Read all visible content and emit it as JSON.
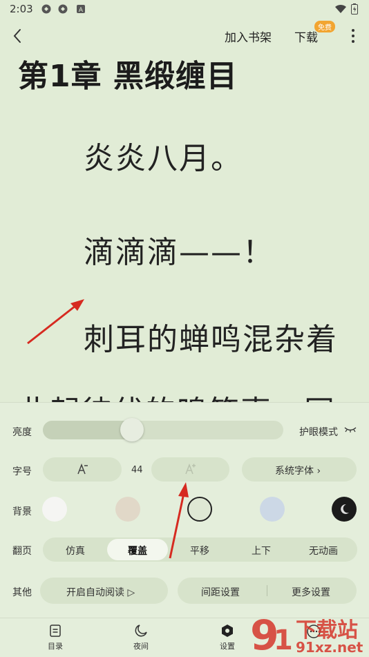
{
  "status_bar": {
    "time": "2:03"
  },
  "top_bar": {
    "add_to_shelf": "加入书架",
    "download": "下载",
    "free_badge": "免费"
  },
  "reader": {
    "chapter_title": "第1章 黑缎缠目",
    "paragraphs": [
      "炎炎八月。",
      "滴滴滴——！",
      "刺耳的蝉鸣混杂着",
      "此起彼伏的鸣笛声，同"
    ]
  },
  "settings": {
    "brightness_label": "亮度",
    "brightness_level": 0.37,
    "eye_care_label": "护眼模式",
    "font_size_label": "字号",
    "font_size_value": "44",
    "system_font_label": "系统字体 ›",
    "background_label": "背景",
    "page_turn_label": "翻页",
    "page_turn_options": [
      "仿真",
      "覆盖",
      "平移",
      "上下",
      "无动画"
    ],
    "page_turn_selected": "覆盖",
    "other_label": "其他",
    "auto_read_label": "开启自动阅读 ▷",
    "spacing_label": "间距设置",
    "more_settings_label": "更多设置"
  },
  "bottom_nav": [
    "目录",
    "夜间",
    "设置"
  ],
  "colors": {
    "page_background": "#e1ecd6",
    "swatch_white": "#f5f5f3",
    "swatch_beige": "#e1d8c8",
    "swatch_green": "#dfe8d4",
    "swatch_blue": "#ccd8e6",
    "swatch_dark": "#1b1b1b",
    "annotation_arrow": "#d62a20",
    "free_badge": "#f2a531"
  },
  "watermark": "91xz.net 下载站"
}
